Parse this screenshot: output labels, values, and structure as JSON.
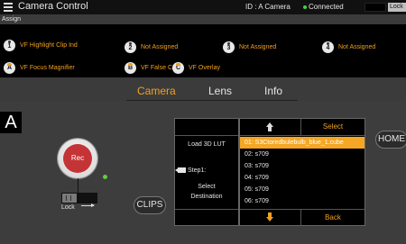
{
  "titlebar": {
    "title": "Camera Control",
    "camera_id": "ID : A Camera",
    "status": "Connected",
    "lock_label": "Lock"
  },
  "assign": {
    "label": "Assign",
    "keys": [
      {
        "badge": "1",
        "label": "VF Highlight Clip Ind"
      },
      {
        "badge": "2",
        "label": "Not Assigned"
      },
      {
        "badge": "3",
        "label": "Not Assigned"
      },
      {
        "badge": "4",
        "label": "Not Assigned"
      },
      {
        "badge": "A",
        "label": "VF Focus Magnifier"
      },
      {
        "badge": "B",
        "label": "VF False Color"
      },
      {
        "badge": "C",
        "label": "VF Overlay"
      }
    ]
  },
  "tabs": [
    "Camera",
    "Lens",
    "Info"
  ],
  "camera": {
    "letter": "A",
    "rec_label": "Rec",
    "lock_label": "Lock",
    "clips_label": "CLIPS",
    "home_label": "HOME"
  },
  "lut": {
    "title": "Load 3D LUT",
    "step": "Step1:",
    "select_line1": "Select",
    "select_line2": "Destination",
    "select_button": "Select",
    "back_button": "Back",
    "items": [
      "01: S3Ctoredbulebulb_blue_1.cube",
      "02: s709",
      "03: s709",
      "04: s709",
      "05: s709",
      "06: s709"
    ],
    "selected_index": 0
  },
  "colors": {
    "accent": "#f0a020",
    "rec": "#c43436",
    "connected": "#44d044"
  }
}
